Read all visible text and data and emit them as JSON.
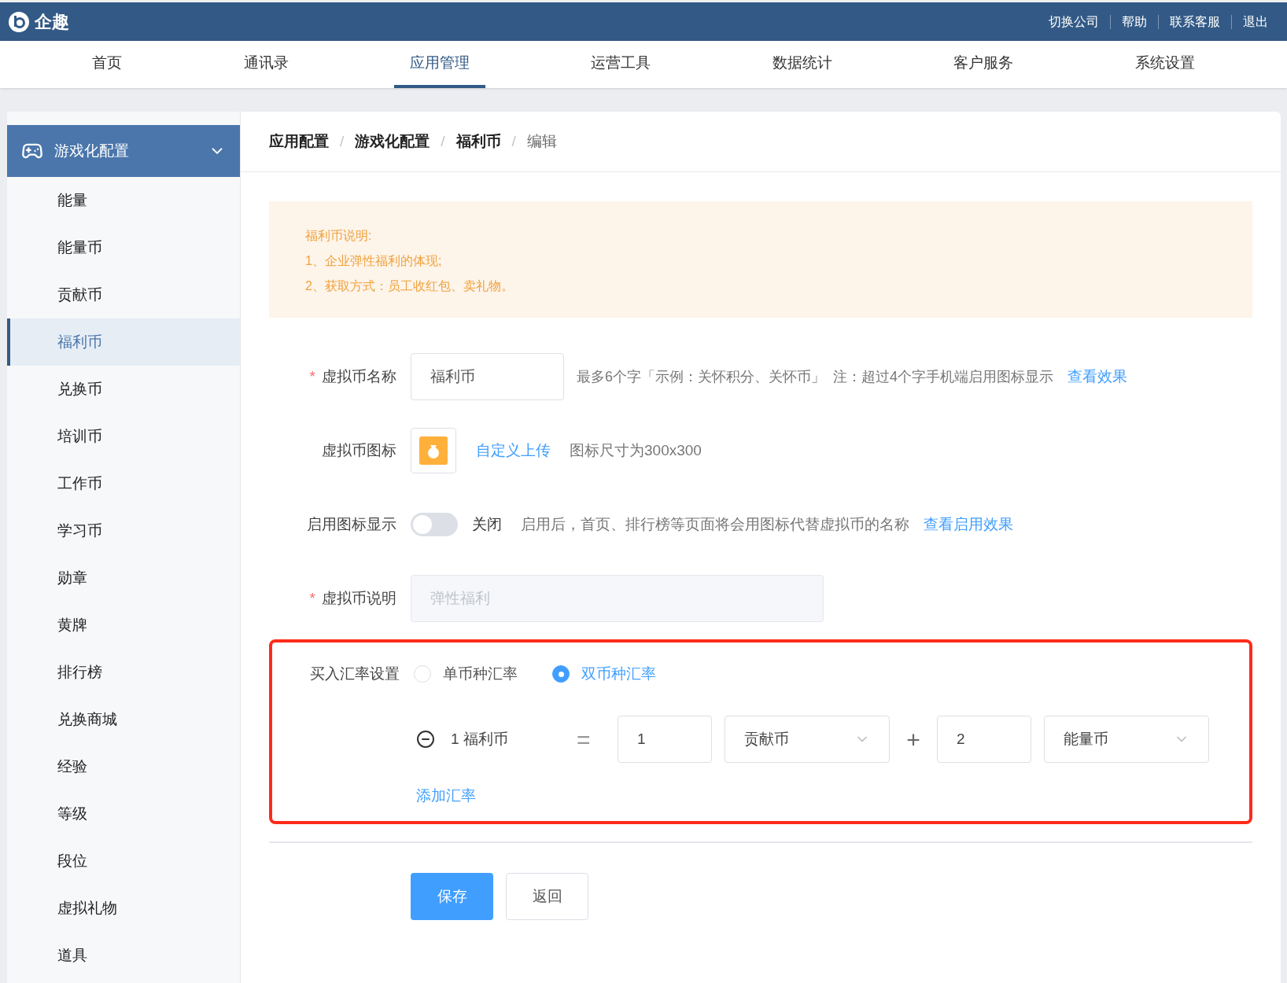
{
  "topbar": {
    "brand": "企趣",
    "links": [
      "切换公司",
      "帮助",
      "联系客服",
      "退出"
    ]
  },
  "nav": [
    {
      "label": "首页",
      "selected": false
    },
    {
      "label": "通讯录",
      "selected": false
    },
    {
      "label": "应用管理",
      "selected": true
    },
    {
      "label": "运营工具",
      "selected": false
    },
    {
      "label": "数据统计",
      "selected": false
    },
    {
      "label": "客户服务",
      "selected": false
    },
    {
      "label": "系统设置",
      "selected": false
    }
  ],
  "sidebar": {
    "group": {
      "label": "游戏化配置",
      "expanded": true
    },
    "items": [
      {
        "label": "能量",
        "selected": false
      },
      {
        "label": "能量币",
        "selected": false
      },
      {
        "label": "贡献币",
        "selected": false
      },
      {
        "label": "福利币",
        "selected": true
      },
      {
        "label": "兑换币",
        "selected": false
      },
      {
        "label": "培训币",
        "selected": false
      },
      {
        "label": "工作币",
        "selected": false
      },
      {
        "label": "学习币",
        "selected": false
      },
      {
        "label": "勋章",
        "selected": false
      },
      {
        "label": "黄牌",
        "selected": false
      },
      {
        "label": "排行榜",
        "selected": false
      },
      {
        "label": "兑换商城",
        "selected": false
      },
      {
        "label": "经验",
        "selected": false
      },
      {
        "label": "等级",
        "selected": false
      },
      {
        "label": "段位",
        "selected": false
      },
      {
        "label": "虚拟礼物",
        "selected": false
      },
      {
        "label": "道具",
        "selected": false
      }
    ]
  },
  "breadcrumb": [
    {
      "kind": "link",
      "text": "应用配置"
    },
    {
      "kind": "separator",
      "text": "/"
    },
    {
      "kind": "link",
      "text": "游戏化配置"
    },
    {
      "kind": "separator",
      "text": "/"
    },
    {
      "kind": "link",
      "text": "福利币"
    },
    {
      "kind": "separator",
      "text": "/"
    },
    {
      "kind": "current",
      "text": "编辑"
    }
  ],
  "notice": [
    "福利币说明:",
    "1、企业弹性福利的体现;",
    "2、获取方式：员工收红包、卖礼物。"
  ],
  "form": [
    {
      "kind": "text",
      "label": "虚拟币名称",
      "required_mark": "*",
      "value": "福利币",
      "hint": "最多6个字「示例：关怀积分、关怀币」  注：超过4个字手机端启用图标显示",
      "link": "查看效果"
    },
    {
      "kind": "icon",
      "label": "虚拟币图标",
      "link": "自定义上传",
      "hint": "图标尺寸为300x300"
    },
    {
      "kind": "toggle",
      "label": "启用图标显示",
      "on": false,
      "state_text": "关闭",
      "hint": "启用后，首页、排行榜等页面将会用图标代替虚拟币的名称",
      "link": "查看启用效果"
    },
    {
      "kind": "disabled",
      "label": "虚拟币说明",
      "required_mark": "*",
      "placeholder": "弹性福利"
    }
  ],
  "rate": {
    "label": "买入汇率设置",
    "highlighted": true,
    "options": [
      {
        "label": "单币种汇率",
        "selected": false
      },
      {
        "label": "双币种汇率",
        "selected": true
      }
    ],
    "rows": [
      {
        "base": "1 福利币",
        "equals": "=",
        "amount_1": "1",
        "currency_1": "贡献币",
        "plus": "+",
        "amount_2": "2",
        "currency_2": "能量币"
      }
    ],
    "add_link": "添加汇率"
  },
  "buttons": [
    {
      "kind": "primary",
      "label": "保存"
    },
    {
      "kind": "default",
      "label": "返回"
    }
  ]
}
